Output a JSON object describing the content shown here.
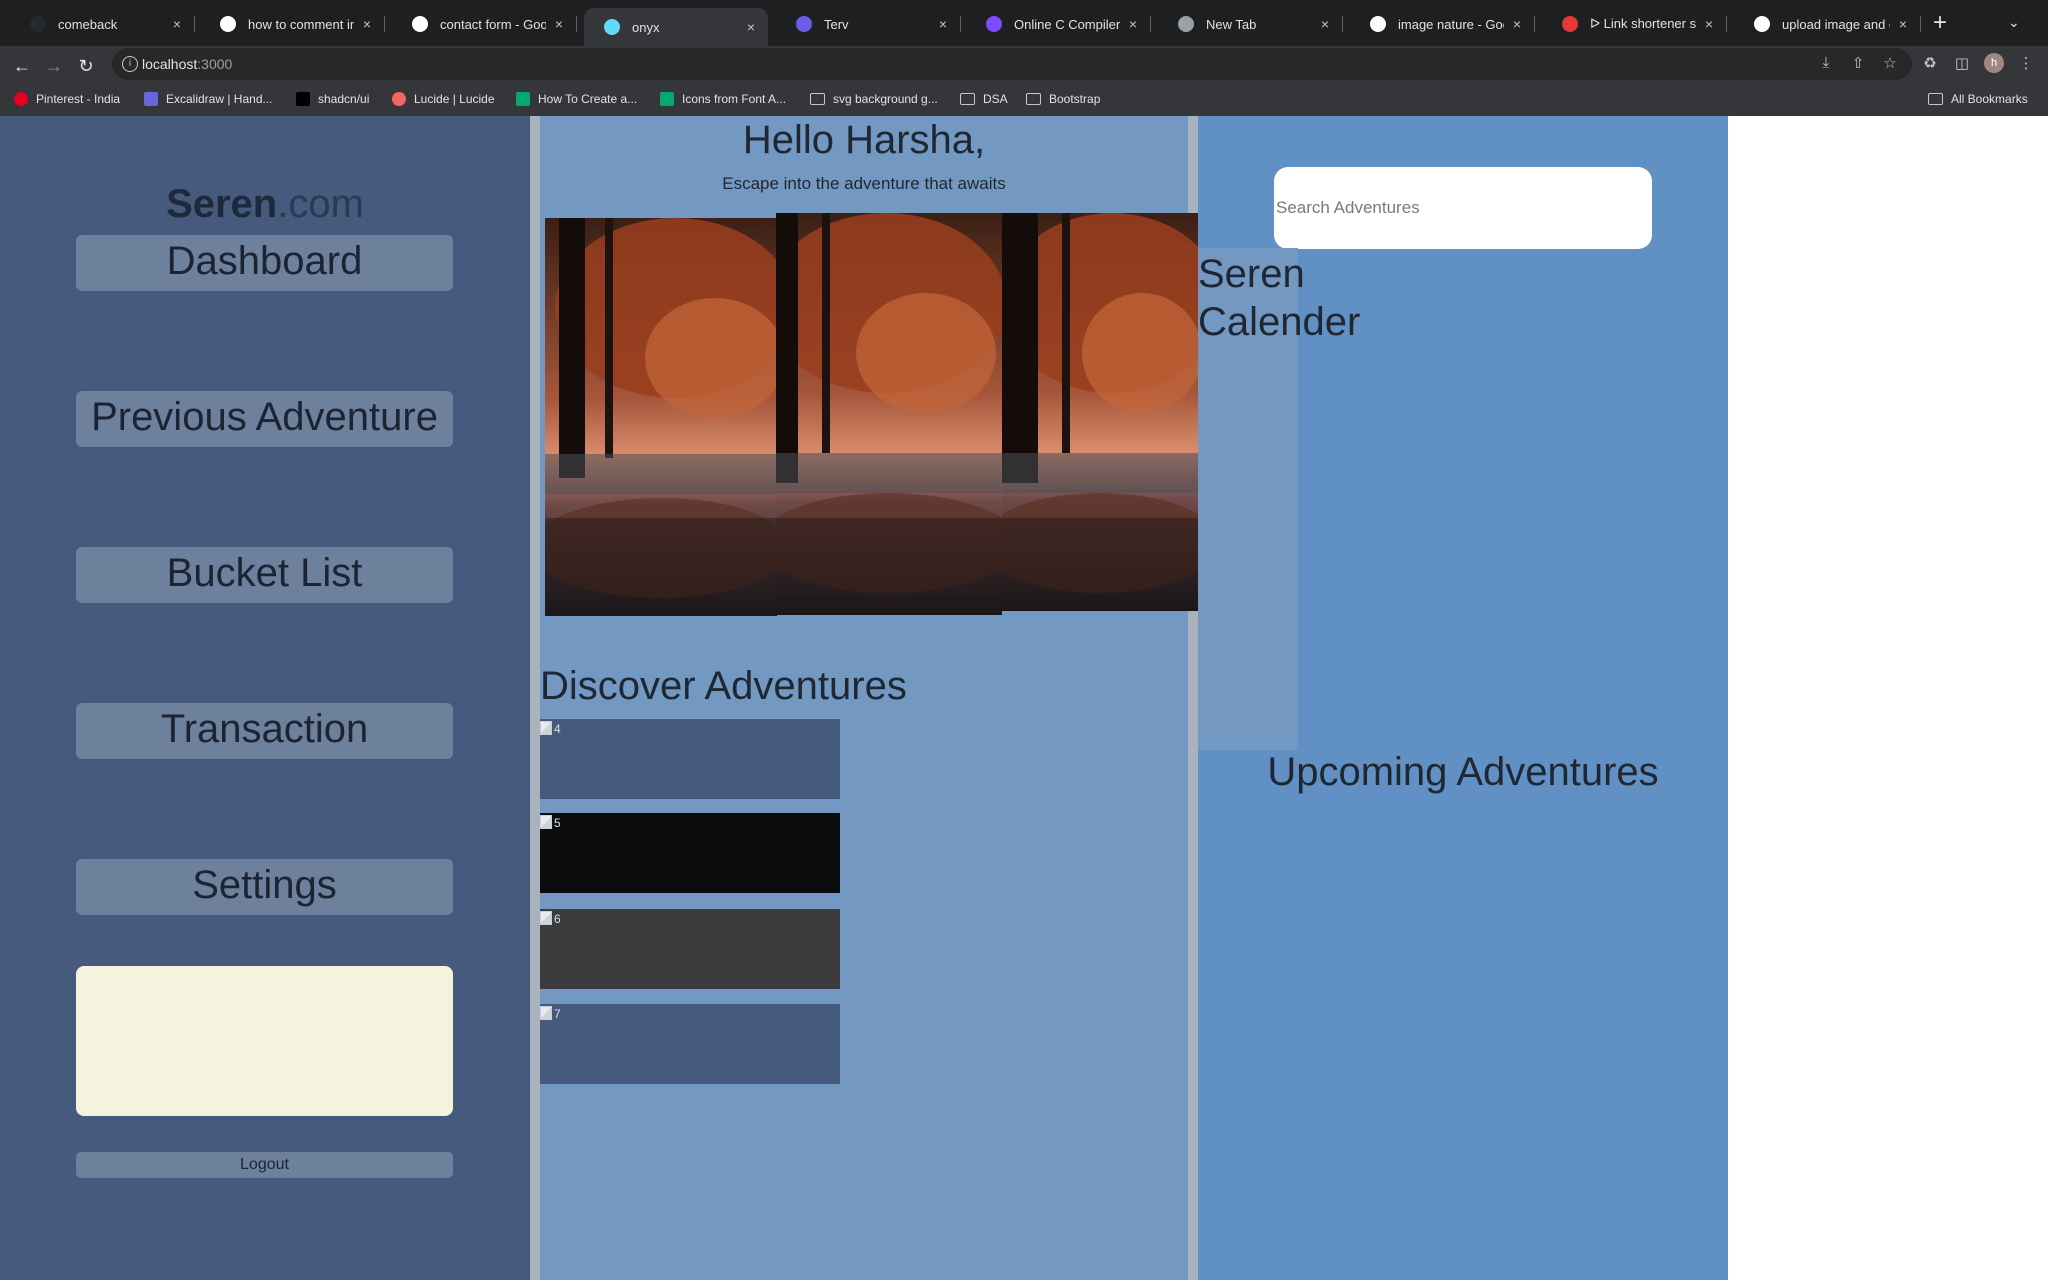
{
  "browser": {
    "tabs": [
      {
        "label": "comeback",
        "favicon": "github-icon"
      },
      {
        "label": "how to comment in re",
        "favicon": "google-icon"
      },
      {
        "label": "contact form - Googl",
        "favicon": "google-icon"
      },
      {
        "label": "onyx",
        "favicon": "react-icon",
        "active": true
      },
      {
        "label": "Terv",
        "favicon": "terv-icon"
      },
      {
        "label": "Online C Compiler",
        "favicon": "compiler-icon"
      },
      {
        "label": "New Tab",
        "favicon": "chrome-icon"
      },
      {
        "label": "image nature - Googl",
        "favicon": "google-icon"
      },
      {
        "label": "ᐅ Link shortener serv",
        "favicon": "link-icon"
      },
      {
        "label": "upload image and ge",
        "favicon": "google-icon"
      }
    ],
    "new_tab_symbol": "+",
    "url_host": "localhost",
    "url_port": ":3000",
    "profile_initial": "h",
    "bookmarks": [
      {
        "label": "Pinterest - India",
        "icon": "pinterest-icon"
      },
      {
        "label": "Excalidraw | Hand...",
        "icon": "excalidraw-icon"
      },
      {
        "label": "shadcn/ui",
        "icon": "shadcn-icon"
      },
      {
        "label": "Lucide | Lucide",
        "icon": "lucide-icon"
      },
      {
        "label": "How To Create a...",
        "icon": "w3-icon"
      },
      {
        "label": "Icons from Font A...",
        "icon": "w3-icon"
      },
      {
        "label": "svg background g...",
        "icon": "folder-icon"
      },
      {
        "label": "DSA",
        "icon": "folder-icon"
      },
      {
        "label": "Bootstrap",
        "icon": "folder-icon"
      }
    ],
    "all_bookmarks": "All Bookmarks"
  },
  "sidebar": {
    "brand_bold": "Seren",
    "brand_rest": ".com",
    "items": [
      {
        "label": "Dashboard"
      },
      {
        "label": "Previous Adventure"
      },
      {
        "label": "Bucket List"
      },
      {
        "label": "Transaction"
      },
      {
        "label": "Settings"
      }
    ],
    "logout_label": "Logout"
  },
  "main": {
    "greeting": "Hello Harsha,",
    "tagline": "Escape into the adventure that awaits",
    "discover_title": "Discover Adventures",
    "adventure_cards": [
      {
        "alt": "4",
        "color": "#455a7c"
      },
      {
        "alt": "5",
        "color": "#0b0c0e"
      },
      {
        "alt": "6",
        "color": "#3c3c3f"
      },
      {
        "alt": "7",
        "color": "#455a7c"
      }
    ]
  },
  "right": {
    "search_placeholder": "Search Adventures",
    "calendar_title": "Seren Calender",
    "upcoming_title": "Upcoming Adventures"
  }
}
